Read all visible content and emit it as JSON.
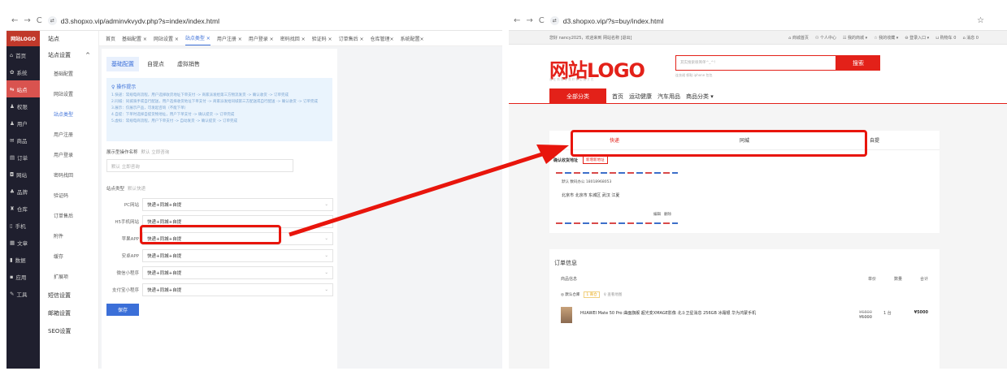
{
  "left": {
    "url": "d3.shopxo.vip/adminvkvydv.php?s=index/index.html",
    "logo": "网站LOGO",
    "nav": [
      {
        "icon": "home-icon",
        "label": "首页"
      },
      {
        "icon": "gear-icon",
        "label": "系统"
      },
      {
        "icon": "sliders-icon",
        "label": "站点"
      },
      {
        "icon": "user-icon",
        "label": "权限"
      },
      {
        "icon": "user-icon",
        "label": "用户"
      },
      {
        "icon": "mail-icon",
        "label": "商品"
      },
      {
        "icon": "list-icon",
        "label": "订单"
      },
      {
        "icon": "chat-icon",
        "label": "网站"
      },
      {
        "icon": "brand-icon",
        "label": "品牌"
      },
      {
        "icon": "warehouse-icon",
        "label": "仓库"
      },
      {
        "icon": "phone-icon",
        "label": "手机"
      },
      {
        "icon": "doc-icon",
        "label": "文章"
      },
      {
        "icon": "chart-icon",
        "label": "数据"
      },
      {
        "icon": "grid-icon",
        "label": "应用"
      },
      {
        "icon": "tool-icon",
        "label": "工具"
      }
    ],
    "sub": {
      "top": "站点",
      "group": "站点设置",
      "items": [
        "基础配置",
        "网站设置",
        "站点类型",
        "用户注册",
        "用户登录",
        "密码找回",
        "验证码",
        "订单售后",
        "附件",
        "缓存",
        "扩展项"
      ],
      "sections": [
        "短信设置",
        "邮箱设置",
        "SEO设置"
      ]
    },
    "tabs": [
      "首页",
      "基础配置 ×",
      "网站设置 ×",
      "站点类型 ×",
      "用户注册 ×",
      "用户登录 ×",
      "密码找回 ×",
      "验证码 ×",
      "订单售后 ×",
      "仓库管理×",
      "系统配置×"
    ],
    "ctabs": [
      "基础配置",
      "自提点",
      "虚拟销售"
    ],
    "tip_title": "♀ 操作提示",
    "tips": [
      "1.快递：常规电商流程，用户选择收货地址下单支付 -> 商家派发给第三方物流发货 -> 确认收货 -> 订单完成",
      "2.同城：同城骑手或自行配送，用户选择收货地址下单支付 -> 商家派发给同城第三方配送或自行配送 -> 确认收货 -> 订单完成",
      "3.展示：仅展示产品，可发起咨询（不能下单）",
      "4.自提：下单时选择自提货物地址，用户下单支付 -> 确认提货 -> 订单完成",
      "5.虚拟：常规电商流程，用户下单支付 -> 自动发货 -> 确认提货 -> 订单完成"
    ],
    "field1_label": "展示型操作名称",
    "field1_hint": "默认 立即咨询",
    "field1_placeholder": "默认 立即咨询",
    "field2_label": "站点类型",
    "field2_hint": "默认快递",
    "rows": [
      {
        "label": "PC网站",
        "value": "快递+同城+自提"
      },
      {
        "label": "H5手机网站",
        "value": "快递+同城+自提"
      },
      {
        "label": "苹果APP",
        "value": "快递+同城+自提"
      },
      {
        "label": "安卓APP",
        "value": "快递+同城+自提"
      },
      {
        "label": "微信小程序",
        "value": "快递+同城+自提"
      },
      {
        "label": "支付宝小程序",
        "value": "快递+同城+自提"
      }
    ],
    "save": "保存"
  },
  "right": {
    "url": "d3.shopxo.vip/?s=buy/index.html",
    "topbar_left": "您好 nancy2025，欢迎来到 网站名称 [退出]",
    "topbar_right": [
      "⌂ 商城首页",
      "⚇ 个人中心",
      "☷ 我的商城 ▾",
      "☆ 我的收藏 ▾",
      "⊖ 登录入口 ▾",
      "⊔ 购物车 0",
      "⌂ 消息 0"
    ],
    "logo": "网站LOGO",
    "logo_sub": "自 在 购 物 享 受 好 物 生 活 方 式",
    "search_placeholder": "其实搜索很简单^_^!",
    "search_btn": "搜索",
    "hot": "连衣裙  帆鞋  iphone  包包",
    "menu": [
      "全部分类",
      "首页",
      "运动健康",
      "汽车用品",
      "商品分类 ▾"
    ],
    "dtabs": [
      "快递",
      "同城",
      "自提"
    ],
    "addr_title": "确认收货地址",
    "addr_add": "新增新地址",
    "env_top": "默认   数码办公 18018968053",
    "env_addr": "北京市 北京市 东城区 武汉 江夏",
    "env_actions": [
      "编辑",
      "删除"
    ],
    "order_title": "订单信息",
    "cols_left": "商品信息",
    "cols_right": [
      "单价",
      "数量",
      "合计"
    ],
    "warehouse": "◎ 默认仓库",
    "wh_tag1": "1 商仓",
    "wh_tag2": "♀ 查看地图",
    "product": "HUAWEI Mate 50 Pro 曲面旗舰 超光变XMAGE影像 北斗卫星消息 256GB 冰霜银 华为鸿蒙手机",
    "price_old": "¥6800",
    "price_new": "¥5000",
    "qty": "1 台",
    "total": "¥5000"
  }
}
